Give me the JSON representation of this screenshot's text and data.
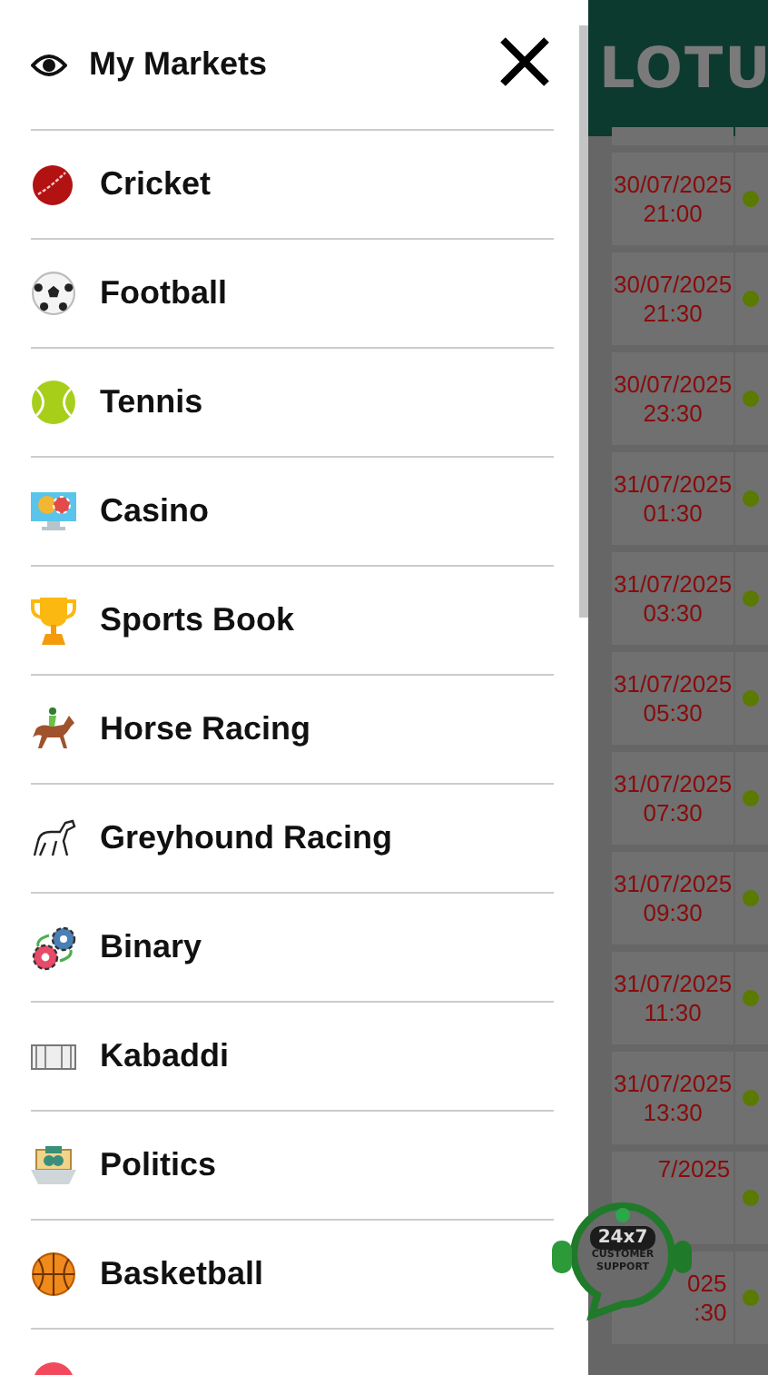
{
  "menu": {
    "items": [
      {
        "label": "My Markets"
      },
      {
        "label": "Cricket"
      },
      {
        "label": "Football"
      },
      {
        "label": "Tennis"
      },
      {
        "label": "Casino"
      },
      {
        "label": "Sports Book"
      },
      {
        "label": "Horse Racing"
      },
      {
        "label": "Greyhound Racing"
      },
      {
        "label": "Binary"
      },
      {
        "label": "Kabaddi"
      },
      {
        "label": "Politics"
      },
      {
        "label": "Basketball"
      }
    ],
    "cut_item": true
  },
  "header": {
    "logo": "LOTU"
  },
  "events": [
    {
      "date": "30/07/2025",
      "time": "21:00"
    },
    {
      "date": "30/07/2025",
      "time": "21:30"
    },
    {
      "date": "30/07/2025",
      "time": "23:30"
    },
    {
      "date": "31/07/2025",
      "time": "01:30"
    },
    {
      "date": "31/07/2025",
      "time": "03:30"
    },
    {
      "date": "31/07/2025",
      "time": "05:30"
    },
    {
      "date": "31/07/2025",
      "time": "07:30"
    },
    {
      "date": "31/07/2025",
      "time": "09:30"
    },
    {
      "date": "31/07/2025",
      "time": "11:30"
    },
    {
      "date": "31/07/2025",
      "time": "13:30"
    },
    {
      "date": "7/2025"
    },
    {
      "date": "025",
      "time": ":30"
    }
  ],
  "support": {
    "badge": "24x7",
    "lines": [
      "CUSTOMER",
      "SUPPORT"
    ]
  }
}
